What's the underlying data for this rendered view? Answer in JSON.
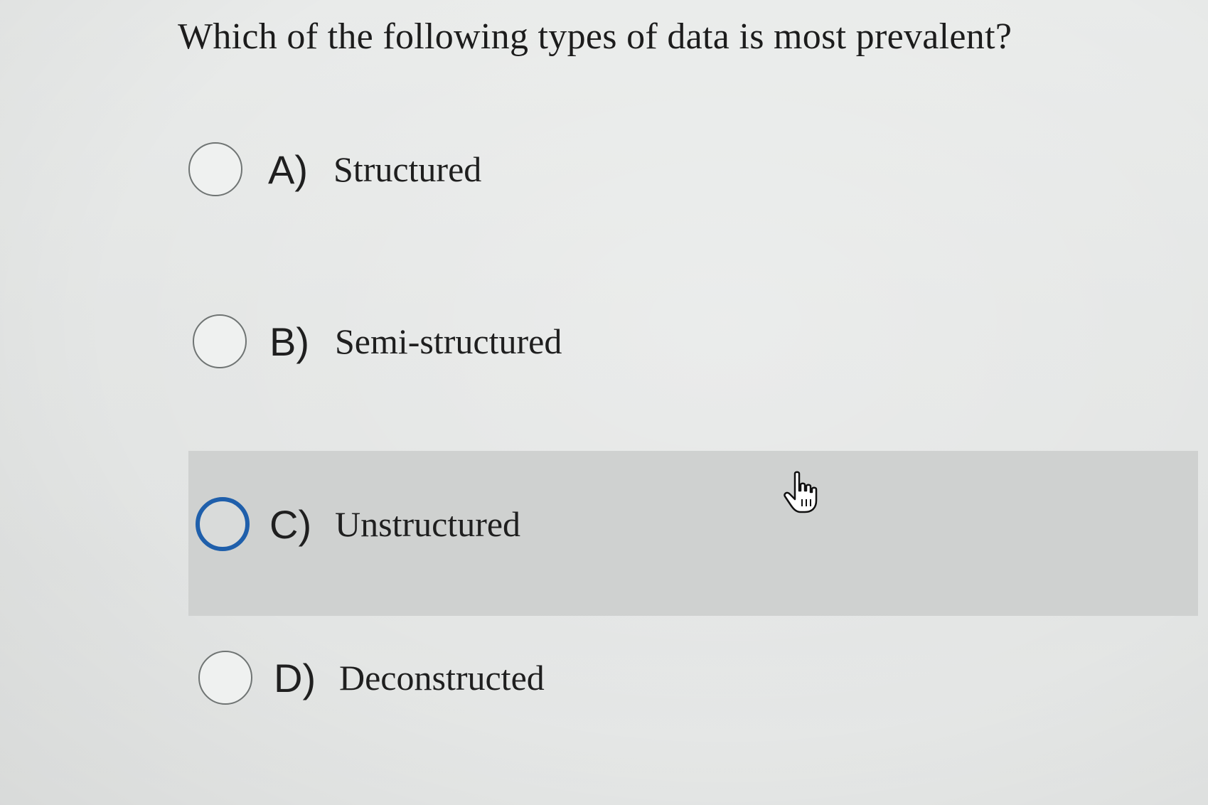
{
  "question": {
    "text": "Which of the following types of data is most prevalent?"
  },
  "options": [
    {
      "letter": "A)",
      "label": "Structured",
      "state": "unselected"
    },
    {
      "letter": "B)",
      "label": "Semi-structured",
      "state": "unselected"
    },
    {
      "letter": "C)",
      "label": "Unstructured",
      "state": "hovered"
    },
    {
      "letter": "D)",
      "label": "Deconstructed",
      "state": "unselected"
    }
  ],
  "cursor": {
    "icon": "pointer-hand-icon"
  },
  "colors": {
    "hover_background": "#cfd1d0",
    "hover_radio_border": "#1f5fab",
    "radio_border": "#6f7473"
  }
}
